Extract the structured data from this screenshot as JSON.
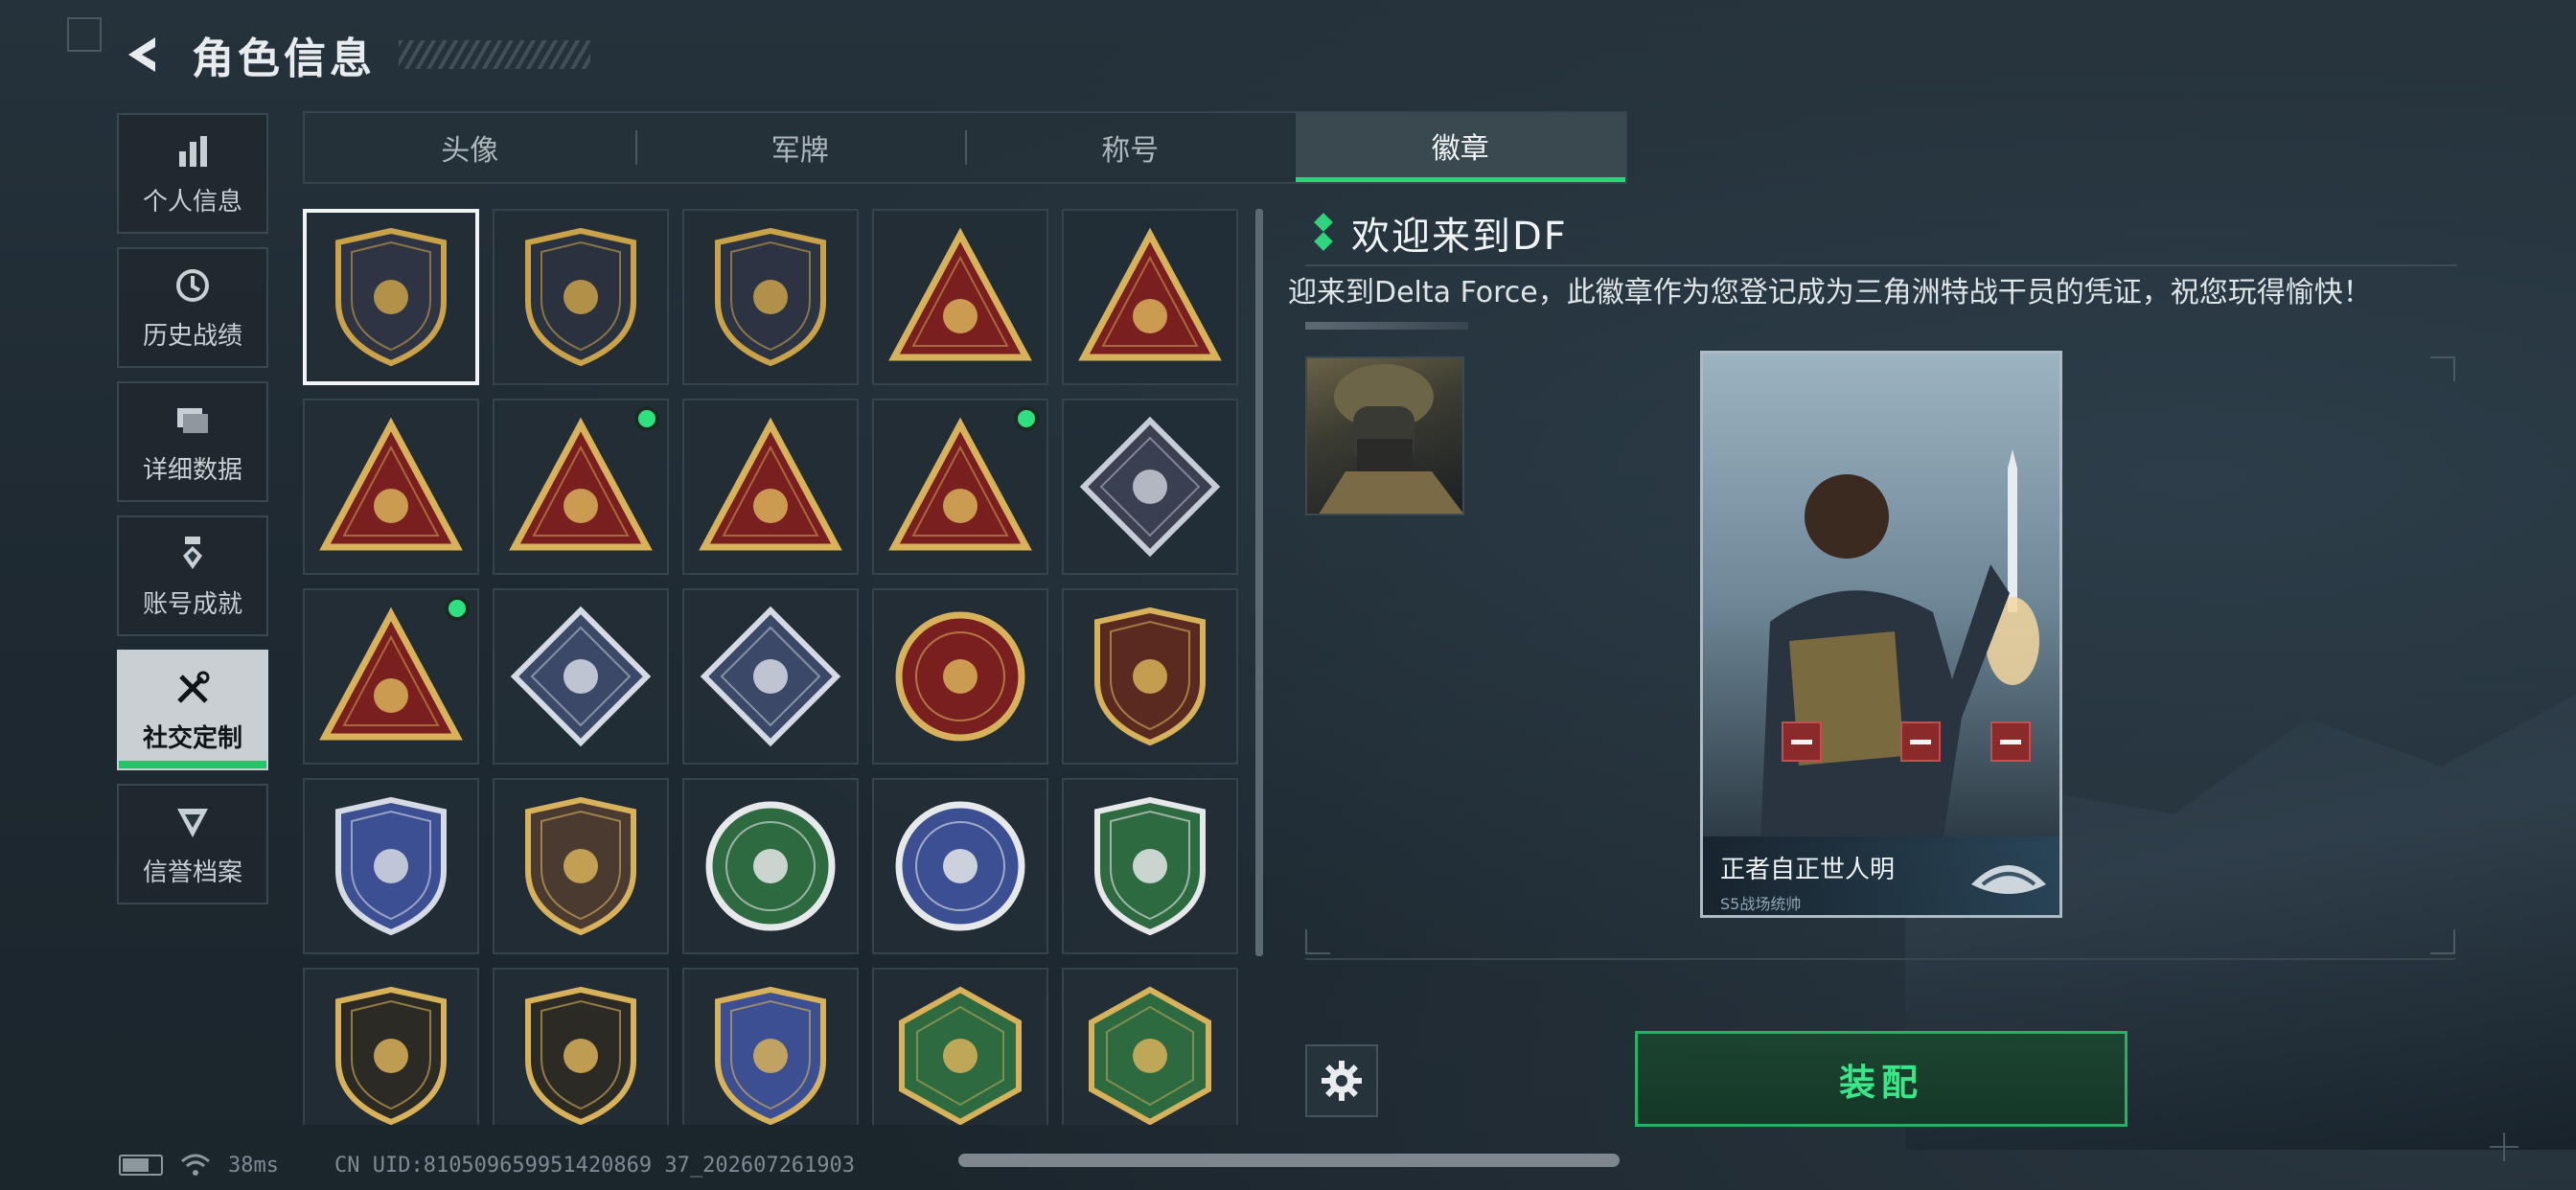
{
  "header": {
    "title": "角色信息"
  },
  "sidenav": [
    {
      "label": "个人信息",
      "icon": "bar-chart-icon"
    },
    {
      "label": "历史战绩",
      "icon": "history-clock-icon"
    },
    {
      "label": "详细数据",
      "icon": "folder-icon"
    },
    {
      "label": "账号成就",
      "icon": "achievement-medal-icon"
    },
    {
      "label": "社交定制",
      "icon": "tools-icon",
      "active": true
    },
    {
      "label": "信誉档案",
      "icon": "reputation-shield-icon"
    }
  ],
  "tabs": [
    {
      "label": "头像"
    },
    {
      "label": "军牌"
    },
    {
      "label": "称号"
    },
    {
      "label": "徽章",
      "active": true
    }
  ],
  "badges": [
    {
      "name": "delta-shield-badge",
      "shape": "shield",
      "colors": [
        "#2e3444",
        "#c9a24a"
      ],
      "selected": true,
      "new": false
    },
    {
      "name": "helicopter-badge",
      "shape": "shield",
      "colors": [
        "#2a3240",
        "#c9a24a"
      ],
      "new": false
    },
    {
      "name": "dagger-badge",
      "shape": "shield",
      "colors": [
        "#2c3342",
        "#c9a24a"
      ],
      "new": false
    },
    {
      "name": "hand-sign-badge",
      "shape": "triangle",
      "colors": [
        "#7a1f1f",
        "#d8b25a"
      ],
      "new": false
    },
    {
      "name": "nest-egg-badge",
      "shape": "triangle",
      "colors": [
        "#7a1f1f",
        "#d8b25a"
      ],
      "new": false
    },
    {
      "name": "number-one-badge",
      "shape": "triangle",
      "colors": [
        "#7a1f1f",
        "#d8b25a"
      ],
      "new": false
    },
    {
      "name": "usb-drive-badge",
      "shape": "triangle",
      "colors": [
        "#7a1f1f",
        "#d8b25a"
      ],
      "new": true
    },
    {
      "name": "soldiers-badge",
      "shape": "triangle",
      "colors": [
        "#7a1f1f",
        "#d8b25a"
      ],
      "new": false
    },
    {
      "name": "rocket-badge",
      "shape": "triangle",
      "colors": [
        "#7a1f1f",
        "#d8b25a"
      ],
      "new": true
    },
    {
      "name": "rose-badge",
      "shape": "diamond",
      "colors": [
        "#3a3f52",
        "#c8ccd6"
      ],
      "new": false
    },
    {
      "name": "diver-badge",
      "shape": "triangle",
      "colors": [
        "#7a1f1f",
        "#d8b25a"
      ],
      "new": true
    },
    {
      "name": "launcher-badge",
      "shape": "diamond",
      "colors": [
        "#3b4868",
        "#d6dae4"
      ],
      "new": false
    },
    {
      "name": "boat-badge",
      "shape": "diamond",
      "colors": [
        "#3b4868",
        "#d6dae4"
      ],
      "new": false
    },
    {
      "name": "star-skull-badge",
      "shape": "circle",
      "colors": [
        "#7a1f1f",
        "#d8b25a"
      ],
      "new": false
    },
    {
      "name": "chevron-wing-badge",
      "shape": "shield",
      "colors": [
        "#5a2a20",
        "#d8b25a"
      ],
      "new": false
    },
    {
      "name": "wreath-shield-badge",
      "shape": "shield",
      "colors": [
        "#3b4f92",
        "#d6dae4"
      ],
      "new": false
    },
    {
      "name": "gem-badge",
      "shape": "shield",
      "colors": [
        "#4a3a30",
        "#d8b25a"
      ],
      "new": false
    },
    {
      "name": "mech-badge",
      "shape": "circle",
      "colors": [
        "#2d6a40",
        "#e6e8ea"
      ],
      "new": false
    },
    {
      "name": "star-tank-badge",
      "shape": "circle",
      "colors": [
        "#3b4f92",
        "#e6e8ea"
      ],
      "new": false
    },
    {
      "name": "rifle-crosshair-badge",
      "shape": "shield",
      "colors": [
        "#2d6a40",
        "#e6e8ea"
      ],
      "new": false
    },
    {
      "name": "smg-badge",
      "shape": "shield",
      "colors": [
        "#2c2a24",
        "#d8b25a"
      ],
      "new": false
    },
    {
      "name": "shotgun-badge",
      "shape": "shield",
      "colors": [
        "#2c2a24",
        "#d8b25a"
      ],
      "new": false
    },
    {
      "name": "crossed-knife-badge",
      "shape": "shield",
      "colors": [
        "#3b4f92",
        "#d8b25a"
      ],
      "new": false
    },
    {
      "name": "hornet-badge",
      "shape": "hexagon",
      "colors": [
        "#2d6a40",
        "#d8b25a"
      ],
      "new": false
    },
    {
      "name": "hornet-badge-2",
      "shape": "hexagon",
      "colors": [
        "#2d6a40",
        "#d8b25a"
      ],
      "new": false
    }
  ],
  "detail": {
    "title": "欢迎来到DF",
    "description": "迎来到Delta Force，此徽章作为您登记成为三角洲特战干员的凭证，祝您玩得愉快！"
  },
  "preview": {
    "name": "正者自正世人明",
    "subtitle": "S5战场统帅"
  },
  "equip_label": "装配",
  "footer": {
    "ping": "38ms",
    "uid": "CN UID:810509659951420869 37_202607261903"
  },
  "colors": {
    "accent_green": "#2ed47a",
    "new_dot": "#2fe07e",
    "remove_red": "#8a2a2a"
  }
}
